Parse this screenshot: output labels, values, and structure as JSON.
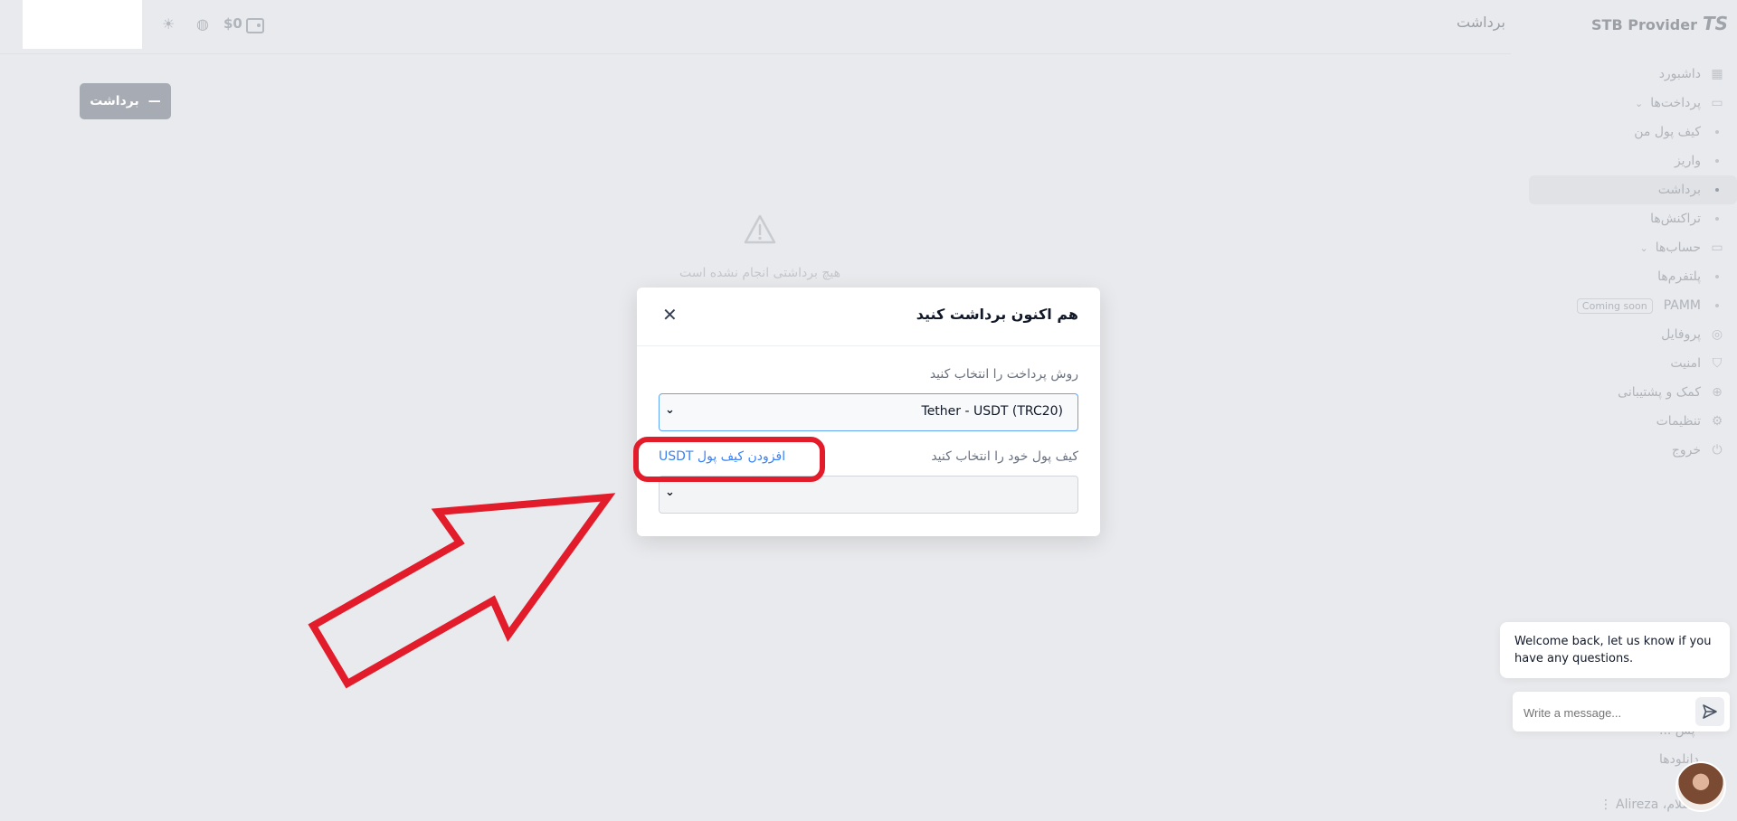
{
  "topbar": {
    "balance": "$0",
    "page_title": "برداشت",
    "brand_name": "STB Provider",
    "brand_logo": "TS"
  },
  "sidebar": {
    "items": [
      {
        "label": "داشبورد",
        "type": "main",
        "icon": "grid-icon"
      },
      {
        "label": "پرداخت‌ها",
        "type": "main",
        "icon": "card-icon",
        "expandable": true
      },
      {
        "label": "کیف پول من",
        "type": "sub"
      },
      {
        "label": "واریز",
        "type": "sub"
      },
      {
        "label": "برداشت",
        "type": "sub",
        "active": true
      },
      {
        "label": "تراکنش‌ها",
        "type": "sub"
      },
      {
        "label": "حساب‌ها",
        "type": "main",
        "icon": "monitor-icon",
        "expandable": true
      },
      {
        "label": "پلتفرم‌ها",
        "type": "sub"
      },
      {
        "label": "PAMM",
        "type": "sub",
        "badge": "Coming soon"
      },
      {
        "label": "پروفایل",
        "type": "main",
        "icon": "user-icon"
      },
      {
        "label": "امنیت",
        "type": "main",
        "icon": "shield-icon"
      },
      {
        "label": "کمک و پشتیبانی",
        "type": "main",
        "icon": "lifebuoy-icon"
      },
      {
        "label": "تنظیمات",
        "type": "main",
        "icon": "gear-icon"
      },
      {
        "label": "خروج",
        "type": "main",
        "icon": "power-icon"
      }
    ],
    "bottom_items": [
      "پش ...",
      "دانلودها"
    ],
    "user_greeting": "سلام، Alireza"
  },
  "main": {
    "withdraw_button": "برداشت",
    "empty_state": "هیچ برداشتی انجام نشده است"
  },
  "modal": {
    "title": "هم اکنون برداشت کنید",
    "method_label": "روش پرداخت را انتخاب کنید",
    "method_value": "Tether - USDT (TRC20)",
    "wallet_label": "کیف پول خود را انتخاب کنید",
    "wallet_value": "",
    "add_wallet_link": "افزودن کیف پول USDT"
  },
  "chat": {
    "welcome": "Welcome back, let us know if you have any questions.",
    "input_placeholder": "Write a message..."
  },
  "colors": {
    "annotation": "#e21c2a",
    "link": "#3b82f6",
    "focus_border": "#60a5fa"
  }
}
